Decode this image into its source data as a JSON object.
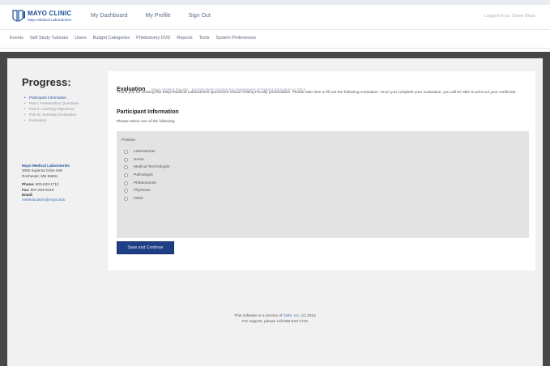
{
  "header": {
    "logo": {
      "line1": "MAYO CLINIC",
      "line2": "Mayo Medical Laboratories"
    },
    "nav": [
      {
        "label": "My Dashboard"
      },
      {
        "label": "My Profile"
      },
      {
        "label": "Sign Out"
      }
    ],
    "logged_in_text": "Logged in as: Diane Bean"
  },
  "subnav": [
    {
      "label": "Events"
    },
    {
      "label": "Self Study Tutorials"
    },
    {
      "label": "Users"
    },
    {
      "label": "Budget Categories"
    },
    {
      "label": "Phlebotomy DVD"
    },
    {
      "label": "Reports"
    },
    {
      "label": "Tools"
    },
    {
      "label": "System Preferences"
    }
  ],
  "sidebar": {
    "title": "Progress:",
    "steps": [
      {
        "label": "Participant Information"
      },
      {
        "label": "Part I: Presentation Questions"
      },
      {
        "label": "Part II: Learning Objectives"
      },
      {
        "label": "Part III: Summary Evaluation"
      },
      {
        "label": "Evaluation"
      }
    ],
    "contact": {
      "org": "Mayo Medical Laboratories",
      "address1": "3050 Superior Drive NW",
      "address2": "Rochester, MN 55901",
      "phone_label": "Phone:",
      "phone": "800-533-1710",
      "fax_label": "Fax:",
      "fax": "507-284-8418",
      "email_label": "Email:",
      "email": "mmleducation@mayo.edu"
    }
  },
  "main": {
    "eval_title": "Evaluation",
    "eval_subtitle": "Mayo Visiting Faculty · Sunrise Beer Garden for Assessment of Patient Education in 2014",
    "intro": "Thank you for viewing this Mayo Medical Laboratories sponsored Virtual Visiting Faculty presentation. Please take time to fill out the following evaluation. Once you complete your evaluation, you will be able to print out your certificate.",
    "section_title": "Participant Information",
    "instruction": "Please select one of the following:",
    "question": {
      "label": "Position",
      "options": [
        {
          "label": "Laboratorian"
        },
        {
          "label": "Nurse"
        },
        {
          "label": "Medical Technologist"
        },
        {
          "label": "Pathologist"
        },
        {
          "label": "Phlebotomist"
        },
        {
          "label": "Physician"
        },
        {
          "label": "Other"
        }
      ]
    },
    "submit_label": "Save and Continue"
  },
  "footer": {
    "line1_prefix": "This software is a service of",
    "line1_link": "CMS, Inc.",
    "line1_suffix": "(c) 2014",
    "line2": "For support, please call 800-533-1710"
  },
  "colors": {
    "brand_blue": "#1f4f9c",
    "button": "#1e3f86",
    "dark_band": "#474747",
    "content_bg": "#f1f1f1"
  }
}
